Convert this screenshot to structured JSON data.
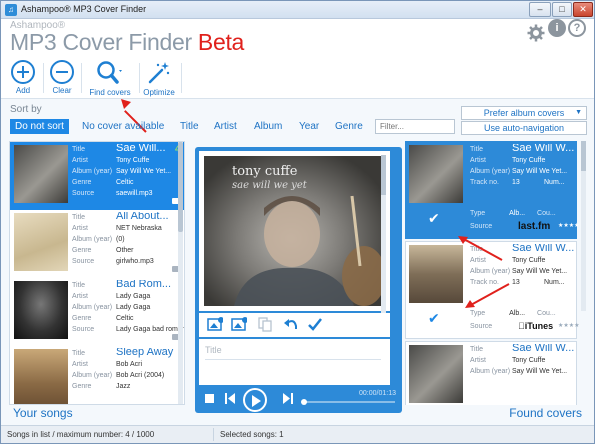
{
  "window": {
    "title": "Ashampoo® MP3 Cover Finder",
    "min": "–",
    "max": "□",
    "close": "✕"
  },
  "header": {
    "brand_small": "Ashampoo®",
    "brand_main": "MP3 Cover Finder",
    "brand_beta": "Beta",
    "icons": [
      "gear-icon",
      "info-icon",
      "help-icon"
    ],
    "info_glyph": "i",
    "help_glyph": "?"
  },
  "toolbar": {
    "add": "Add",
    "clear": "Clear",
    "find_covers": "Find covers",
    "optimize": "Optimize"
  },
  "sort": {
    "label": "Sort by",
    "items": [
      "Do not sort",
      "No cover available",
      "Title",
      "Artist",
      "Album",
      "Year",
      "Genre"
    ],
    "active": "Do not sort",
    "filter_placeholder": "Filter...",
    "prefer_label": "Prefer album covers",
    "autonav_label": "Use auto-navigation"
  },
  "field_labels": {
    "title": "Title",
    "artist": "Artist",
    "album": "Album (year)",
    "genre": "Genre",
    "source": "Source",
    "track": "Track no.",
    "type": "Type"
  },
  "songs": [
    {
      "title": "Sae Will...",
      "artist": "Tony Cuffe",
      "album": "Say Will We Yet...",
      "genre": "Celtic",
      "source": "saewill.mp3",
      "count": "4"
    },
    {
      "title": "All About...",
      "artist": "NET Nebraska",
      "album": "(0)",
      "genre": "Other",
      "source": "girlwho.mp3"
    },
    {
      "title": "Bad Rom...",
      "artist": "Lady Gaga",
      "album": "Lady Gaga",
      "genre": "Celtic",
      "source": "Lady Gaga bad roman..."
    },
    {
      "title": "Sleep Away",
      "artist": "Bob Acri",
      "album": "Bob Acri (2004)",
      "genre": "Jazz",
      "source": ""
    }
  ],
  "cover": {
    "line1": "tony cuffe",
    "line2": "sae will we yet"
  },
  "title_placeholder": "Title",
  "player": {
    "time": "00:00/01:13"
  },
  "found": [
    {
      "title": "Sae Will W...",
      "artist": "Tony Cuffe",
      "album": "Say Will We Yet...",
      "track": "13",
      "track2": "Num...",
      "type": "Alb...",
      "type2": "Cou...",
      "source": "Source",
      "logo": "last.fm",
      "stars": "★★★★",
      "check": "✔"
    },
    {
      "title": "Sae Will W...",
      "artist": "Tony Cuffe",
      "album": "Say Will We Yet...",
      "track": "13",
      "track2": "Num...",
      "type": "Alb...",
      "type2": "Cou...",
      "source": "Source",
      "logo": "iTunes",
      "stars": "★★★★",
      "check": "✔"
    },
    {
      "title": "Sae Will W...",
      "artist": "Tony Cuffe",
      "album": "Say Will We Yet..."
    }
  ],
  "footer": {
    "your_songs": "Your songs",
    "found_covers": "Found covers"
  },
  "status": {
    "songs_in_list": "Songs in list / maximum number: 4 / 1000",
    "selected": "Selected songs: 1"
  },
  "colors": {
    "accent": "#1e88e5",
    "beta": "#e0211c",
    "arrow": "#e0211c"
  }
}
